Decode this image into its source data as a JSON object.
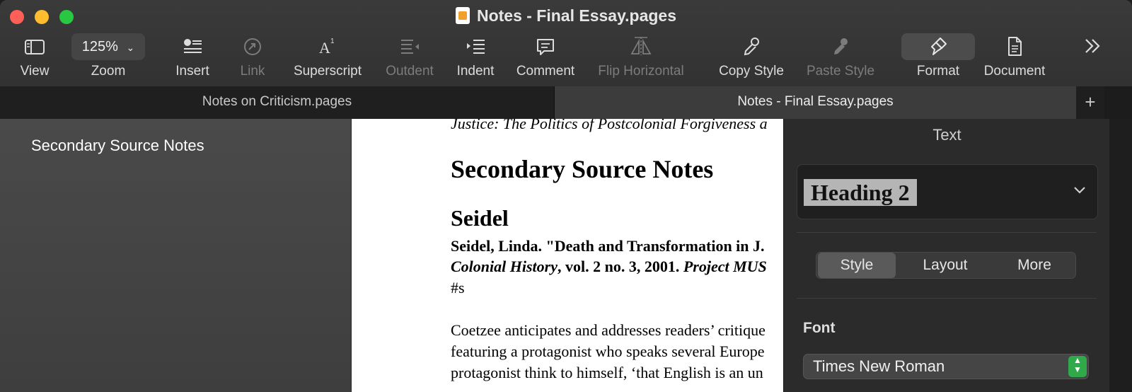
{
  "window": {
    "title": "Notes - Final Essay.pages"
  },
  "toolbar": {
    "view": "View",
    "zoom_value": "125%",
    "zoom": "Zoom",
    "insert": "Insert",
    "link": "Link",
    "superscript": "Superscript",
    "outdent": "Outdent",
    "indent": "Indent",
    "comment": "Comment",
    "flip_horizontal": "Flip Horizontal",
    "copy_style": "Copy Style",
    "paste_style": "Paste Style",
    "format": "Format",
    "document": "Document"
  },
  "tabs": [
    {
      "label": "Notes on Criticism.pages",
      "active": false
    },
    {
      "label": "Notes - Final Essay.pages",
      "active": true
    }
  ],
  "sidebar": {
    "items": [
      {
        "label": "Secondary Source Notes"
      }
    ]
  },
  "document": {
    "line1": "Justice: The Politics of Postcolonial Forgiveness a",
    "heading1": "Secondary Source Notes",
    "heading2": "Seidel",
    "citation1": "Seidel, Linda. \"Death and Transformation in J.",
    "citation2_italic": "Colonial History",
    "citation2_mid": ", vol. 2 no. 3, 2001. ",
    "citation2_italic_end": "Project MUS",
    "hash": "#s",
    "para1": "Coetzee anticipates and addresses readers’ critique",
    "para2": "featuring a protagonist who speaks several Europe",
    "para3": "protagonist think to himself, ‘that English is an un"
  },
  "inspector": {
    "title": "Text",
    "paragraph_style": "Heading 2",
    "tabs": [
      "Style",
      "Layout",
      "More"
    ],
    "active_tab": "Style",
    "font_label": "Font",
    "font_value": "Times New Roman"
  },
  "colors": {
    "traffic_red": "#fe5f57",
    "traffic_yellow": "#febc2e",
    "traffic_green": "#28c840",
    "stepper_green": "#2fa94a"
  }
}
